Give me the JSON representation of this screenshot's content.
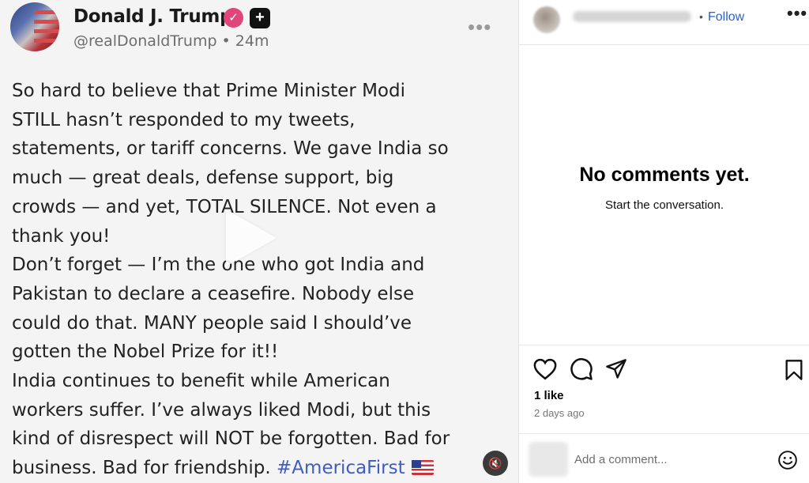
{
  "post": {
    "author_name": "Donald J. Trump",
    "verified_glyph": "✓",
    "plus_glyph": "+",
    "handle": "@realDonaldTrump • 24m",
    "more_glyph": "•••",
    "lines": [
      "So hard to believe that Prime Minister Modi",
      "STILL hasn’t responded to my tweets,",
      "statements, or tariff concerns. We gave India so",
      "much — great deals, defense support, big",
      "crowds — and yet, TOTAL SILENCE. Not even a",
      "thank you!",
      "Don’t forget — I’m the one who got India and",
      "Pakistan to declare a ceasefire. Nobody else",
      "could do that. MANY people said I should’ve",
      "gotten the Nobel Prize for it!!",
      "India continues to benefit while American",
      "workers suffer. I’ve always liked Modi, but this",
      "kind of disrespect will NOT be forgotten. Bad for",
      "business. Bad for friendship."
    ],
    "hashtag": "#AmericaFirst",
    "mute_glyph": "🔇"
  },
  "panel": {
    "follow_dot": "•",
    "follow_label": "Follow",
    "more_glyph": "•••",
    "empty_title": "No comments yet.",
    "empty_subtitle": "Start the conversation.",
    "likes": "1 like",
    "time_ago": "2 days ago",
    "comment_placeholder": "Add a comment..."
  },
  "icons": {
    "verified": "verified-badge-icon",
    "plus": "plus-badge-icon",
    "play": "play-icon",
    "mute": "mute-icon",
    "like": "heart-icon",
    "comment": "comment-icon",
    "share": "share-icon",
    "save": "bookmark-icon",
    "emoji": "emoji-icon"
  },
  "colors": {
    "verified_pink": "#e0457b",
    "follow_blue": "#2c5fcf",
    "hashtag_blue": "#3f5bc4"
  }
}
